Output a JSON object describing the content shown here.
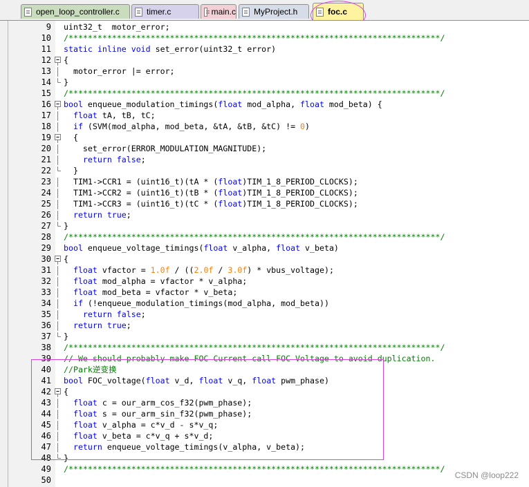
{
  "tabs": [
    {
      "label": "open_loop_controller.c",
      "color": "#c9dcbd",
      "active": false
    },
    {
      "label": "timer.c",
      "color": "#d7d2eb",
      "active": false
    },
    {
      "label": "main.c",
      "color": "#f3cfd6",
      "active": false
    },
    {
      "label": "MyProject.h",
      "color": "#d6dde9",
      "active": false
    },
    {
      "label": "foc.c",
      "color": "#fff3a0",
      "active": true
    }
  ],
  "lines": [
    {
      "n": "9",
      "fold": "",
      "tokens": [
        [
          "uint32_t  motor_error;",
          ""
        ]
      ]
    },
    {
      "n": "10",
      "fold": "",
      "tokens": [
        [
          "/*****************************************************************************/",
          "cm"
        ]
      ]
    },
    {
      "n": "11",
      "fold": "",
      "tokens": [
        [
          "static inline void",
          "kw"
        ],
        [
          " set_error(uint32_t error)",
          ""
        ]
      ]
    },
    {
      "n": "12",
      "fold": "open",
      "tokens": [
        [
          "{",
          ""
        ]
      ]
    },
    {
      "n": "13",
      "fold": "line",
      "tokens": [
        [
          "  motor_error |= error;",
          ""
        ]
      ]
    },
    {
      "n": "14",
      "fold": "end",
      "tokens": [
        [
          "}",
          ""
        ]
      ]
    },
    {
      "n": "15",
      "fold": "",
      "tokens": [
        [
          "/*****************************************************************************/",
          "cm"
        ]
      ]
    },
    {
      "n": "16",
      "fold": "open",
      "tokens": [
        [
          "bool",
          "kw"
        ],
        [
          " enqueue_modulation_timings(",
          ""
        ],
        [
          "float",
          "kw"
        ],
        [
          " mod_alpha, ",
          ""
        ],
        [
          "float",
          "kw"
        ],
        [
          " mod_beta) {",
          ""
        ]
      ]
    },
    {
      "n": "17",
      "fold": "line",
      "tokens": [
        [
          "  ",
          ""
        ],
        [
          "float",
          "kw"
        ],
        [
          " tA, tB, tC;",
          ""
        ]
      ]
    },
    {
      "n": "18",
      "fold": "line",
      "tokens": [
        [
          "  ",
          ""
        ],
        [
          "if",
          "kw"
        ],
        [
          " (SVM(mod_alpha, mod_beta, &tA, &tB, &tC) != ",
          ""
        ],
        [
          "0",
          "num"
        ],
        [
          ")",
          ""
        ]
      ]
    },
    {
      "n": "19",
      "fold": "open",
      "tokens": [
        [
          "  {",
          ""
        ]
      ]
    },
    {
      "n": "20",
      "fold": "line",
      "tokens": [
        [
          "    set_error(ERROR_MODULATION_MAGNITUDE);",
          ""
        ]
      ]
    },
    {
      "n": "21",
      "fold": "line",
      "tokens": [
        [
          "    ",
          ""
        ],
        [
          "return false",
          "kw"
        ],
        [
          ";",
          ""
        ]
      ]
    },
    {
      "n": "22",
      "fold": "end",
      "tokens": [
        [
          "  }",
          ""
        ]
      ]
    },
    {
      "n": "23",
      "fold": "line",
      "tokens": [
        [
          "  TIM1->CCR1 = (uint16_t)(tA * (",
          ""
        ],
        [
          "float",
          "kw"
        ],
        [
          ")TIM_1_8_PERIOD_CLOCKS);",
          ""
        ]
      ]
    },
    {
      "n": "24",
      "fold": "line",
      "tokens": [
        [
          "  TIM1->CCR2 = (uint16_t)(tB * (",
          ""
        ],
        [
          "float",
          "kw"
        ],
        [
          ")TIM_1_8_PERIOD_CLOCKS);",
          ""
        ]
      ]
    },
    {
      "n": "25",
      "fold": "line",
      "tokens": [
        [
          "  TIM1->CCR3 = (uint16_t)(tC * (",
          ""
        ],
        [
          "float",
          "kw"
        ],
        [
          ")TIM_1_8_PERIOD_CLOCKS);",
          ""
        ]
      ]
    },
    {
      "n": "26",
      "fold": "line",
      "tokens": [
        [
          "  ",
          ""
        ],
        [
          "return true",
          "kw"
        ],
        [
          ";",
          ""
        ]
      ]
    },
    {
      "n": "27",
      "fold": "end",
      "tokens": [
        [
          "}",
          ""
        ]
      ]
    },
    {
      "n": "28",
      "fold": "",
      "tokens": [
        [
          "/*****************************************************************************/",
          "cm"
        ]
      ]
    },
    {
      "n": "29",
      "fold": "",
      "tokens": [
        [
          "bool",
          "kw"
        ],
        [
          " enqueue_voltage_timings(",
          ""
        ],
        [
          "float",
          "kw"
        ],
        [
          " v_alpha, ",
          ""
        ],
        [
          "float",
          "kw"
        ],
        [
          " v_beta)",
          ""
        ]
      ]
    },
    {
      "n": "30",
      "fold": "open",
      "tokens": [
        [
          "{",
          ""
        ]
      ]
    },
    {
      "n": "31",
      "fold": "line",
      "tokens": [
        [
          "  ",
          ""
        ],
        [
          "float",
          "kw"
        ],
        [
          " vfactor = ",
          ""
        ],
        [
          "1.0f",
          "num"
        ],
        [
          " / ((",
          ""
        ],
        [
          "2.0f",
          "num"
        ],
        [
          " / ",
          ""
        ],
        [
          "3.0f",
          "num"
        ],
        [
          ") * vbus_voltage);",
          ""
        ]
      ]
    },
    {
      "n": "32",
      "fold": "line",
      "tokens": [
        [
          "  ",
          ""
        ],
        [
          "float",
          "kw"
        ],
        [
          " mod_alpha = vfactor * v_alpha;",
          ""
        ]
      ]
    },
    {
      "n": "33",
      "fold": "line",
      "tokens": [
        [
          "  ",
          ""
        ],
        [
          "float",
          "kw"
        ],
        [
          " mod_beta = vfactor * v_beta;",
          ""
        ]
      ]
    },
    {
      "n": "34",
      "fold": "line",
      "tokens": [
        [
          "  ",
          ""
        ],
        [
          "if",
          "kw"
        ],
        [
          " (!enqueue_modulation_timings(mod_alpha, mod_beta))",
          ""
        ]
      ]
    },
    {
      "n": "35",
      "fold": "line",
      "tokens": [
        [
          "    ",
          ""
        ],
        [
          "return false",
          "kw"
        ],
        [
          ";",
          ""
        ]
      ]
    },
    {
      "n": "36",
      "fold": "line",
      "tokens": [
        [
          "  ",
          ""
        ],
        [
          "return true",
          "kw"
        ],
        [
          ";",
          ""
        ]
      ]
    },
    {
      "n": "37",
      "fold": "end",
      "tokens": [
        [
          "}",
          ""
        ]
      ]
    },
    {
      "n": "38",
      "fold": "",
      "tokens": [
        [
          "/*****************************************************************************/",
          "cm"
        ]
      ]
    },
    {
      "n": "39",
      "fold": "",
      "tokens": [
        [
          "// We should probably make FOC Current call FOC Voltage to avoid duplication.",
          "cm"
        ]
      ]
    },
    {
      "n": "40",
      "fold": "",
      "tokens": [
        [
          "//Park逆变换",
          "cm"
        ]
      ]
    },
    {
      "n": "41",
      "fold": "",
      "tokens": [
        [
          "bool",
          "kw"
        ],
        [
          " FOC_voltage(",
          ""
        ],
        [
          "float",
          "kw"
        ],
        [
          " v_d, ",
          ""
        ],
        [
          "float",
          "kw"
        ],
        [
          " v_q, ",
          ""
        ],
        [
          "float",
          "kw"
        ],
        [
          " pwm_phase)",
          ""
        ]
      ]
    },
    {
      "n": "42",
      "fold": "open",
      "tokens": [
        [
          "{",
          ""
        ]
      ]
    },
    {
      "n": "43",
      "fold": "line",
      "tokens": [
        [
          "  ",
          ""
        ],
        [
          "float",
          "kw"
        ],
        [
          " c = our_arm_cos_f32(pwm_phase);",
          ""
        ]
      ]
    },
    {
      "n": "44",
      "fold": "line",
      "tokens": [
        [
          "  ",
          ""
        ],
        [
          "float",
          "kw"
        ],
        [
          " s = our_arm_sin_f32(pwm_phase);",
          ""
        ]
      ]
    },
    {
      "n": "45",
      "fold": "line",
      "tokens": [
        [
          "  ",
          ""
        ],
        [
          "float",
          "kw"
        ],
        [
          " v_alpha = c*v_d - s*v_q;",
          ""
        ]
      ]
    },
    {
      "n": "46",
      "fold": "line",
      "tokens": [
        [
          "  ",
          ""
        ],
        [
          "float",
          "kw"
        ],
        [
          " v_beta = c*v_q + s*v_d;",
          ""
        ]
      ]
    },
    {
      "n": "47",
      "fold": "line",
      "tokens": [
        [
          "  ",
          ""
        ],
        [
          "return",
          "kw"
        ],
        [
          " enqueue_voltage_timings(v_alpha, v_beta);",
          ""
        ]
      ]
    },
    {
      "n": "48",
      "fold": "end",
      "tokens": [
        [
          "}",
          ""
        ]
      ]
    },
    {
      "n": "49",
      "fold": "",
      "tokens": [
        [
          "/*****************************************************************************/",
          "cm"
        ]
      ]
    },
    {
      "n": "50",
      "fold": "",
      "tokens": [
        [
          "",
          ""
        ]
      ]
    }
  ],
  "watermark": "CSDN @loop222",
  "colors": {
    "keyword": "#0000ff",
    "comment": "#008000",
    "number": "#ff7f00",
    "annotation": "#e040e0"
  }
}
